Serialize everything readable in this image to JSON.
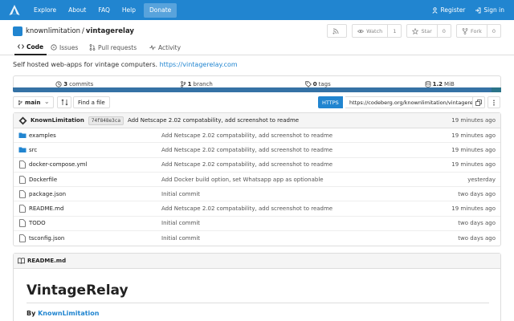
{
  "nav": {
    "links": [
      "Explore",
      "About",
      "FAQ",
      "Help"
    ],
    "donate": "Donate",
    "register": "Register",
    "signin": "Sign in"
  },
  "repo": {
    "owner": "knownlimitation",
    "sep": "/",
    "name": "vintagerelay",
    "watch_label": "Watch",
    "watch_count": "1",
    "star_label": "Star",
    "star_count": "0",
    "fork_label": "Fork",
    "fork_count": "0"
  },
  "tabs": {
    "code": "Code",
    "issues": "Issues",
    "pulls": "Pull requests",
    "activity": "Activity"
  },
  "description": {
    "text": "Self hosted web-apps for vintage computers.",
    "link": "https://vintagerelay.com"
  },
  "stats": {
    "commits_num": "3",
    "commits_label": "commits",
    "branches_num": "1",
    "branches_label": "branch",
    "tags_num": "0",
    "tags_label": "tags",
    "size_num": "1.2",
    "size_unit": "MiB"
  },
  "branch": {
    "current": "main",
    "find_file": "Find a file",
    "protocol": "HTTPS",
    "clone_url": "https://codeberg.org/knownlimitation/vintagerelay.git"
  },
  "last_commit": {
    "author": "KnownLimitation",
    "sha": "74f848e3ca",
    "message": "Add Netscape 2.02 compatability, add screenshot to readme",
    "time": "19 minutes ago"
  },
  "files": [
    {
      "name": "examples",
      "type": "dir",
      "message": "Add Netscape 2.02 compatability, add screenshot to readme",
      "time": "19 minutes ago"
    },
    {
      "name": "src",
      "type": "dir",
      "message": "Add Netscape 2.02 compatability, add screenshot to readme",
      "time": "19 minutes ago"
    },
    {
      "name": "docker-compose.yml",
      "type": "file",
      "message": "Add Netscape 2.02 compatability, add screenshot to readme",
      "time": "19 minutes ago"
    },
    {
      "name": "Dockerfile",
      "type": "file",
      "message": "Add Docker build option, set Whatsapp app as optionable",
      "time": "yesterday"
    },
    {
      "name": "package.json",
      "type": "file",
      "message": "Initial commit",
      "time": "two days ago"
    },
    {
      "name": "README.md",
      "type": "file",
      "message": "Add Netscape 2.02 compatability, add screenshot to readme",
      "time": "19 minutes ago"
    },
    {
      "name": "TODO",
      "type": "file",
      "message": "Initial commit",
      "time": "two days ago"
    },
    {
      "name": "tsconfig.json",
      "type": "file",
      "message": "Initial commit",
      "time": "two days ago"
    }
  ],
  "readme": {
    "filename": "README.md",
    "title": "VintageRelay",
    "by_prefix": "By",
    "by_author": "KnownLimitation"
  },
  "colors": {
    "primary": "#2185d0",
    "lang_main": "#3572a5",
    "lang_second": "#2b7489"
  }
}
